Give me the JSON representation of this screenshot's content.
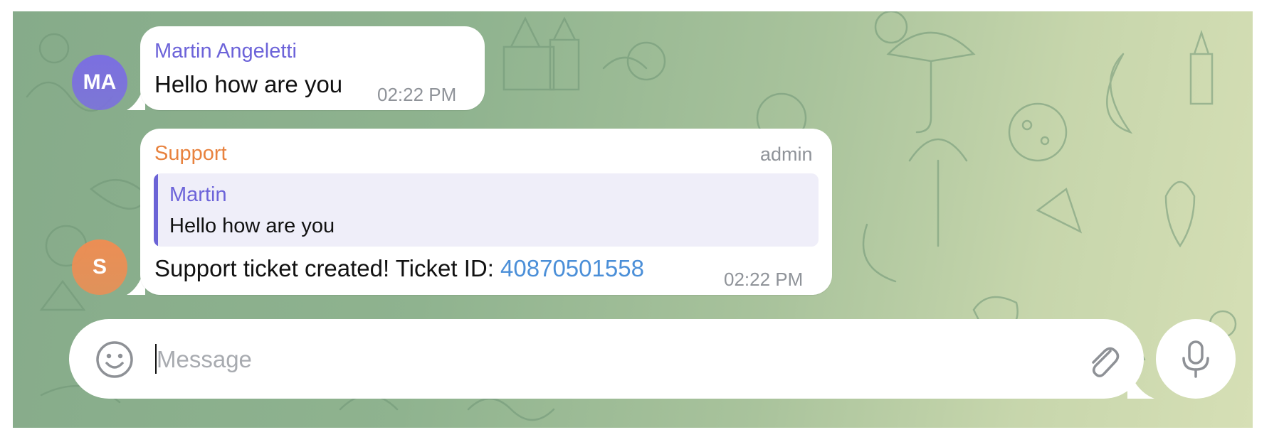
{
  "messages": [
    {
      "sender": "Martin Angeletti",
      "avatar_initials": "MA",
      "avatar_color": "#7b6fe0",
      "sender_color": "#6c63d9",
      "text": "Hello how are you",
      "time": "02:22 PM"
    },
    {
      "sender": "Support",
      "avatar_initials": "S",
      "avatar_color": "#ec8e54",
      "sender_color": "#e8823e",
      "role": "admin",
      "reply": {
        "sender": "Martin",
        "text": "Hello how are you"
      },
      "text_prefix": "Support ticket created! Ticket ID: ",
      "ticket_id": "40870501558",
      "time": "02:22 PM"
    }
  ],
  "composer": {
    "placeholder": "Message",
    "emoji_icon": "smiley-icon",
    "attach_icon": "paperclip-icon",
    "mic_icon": "microphone-icon"
  },
  "colors": {
    "background_start": "#86ab8a",
    "background_end": "#d6dfb5",
    "bubble": "#ffffff",
    "link": "#4b8fd8",
    "quote_bar": "#6b63d6",
    "quote_bg": "#efeef9"
  }
}
